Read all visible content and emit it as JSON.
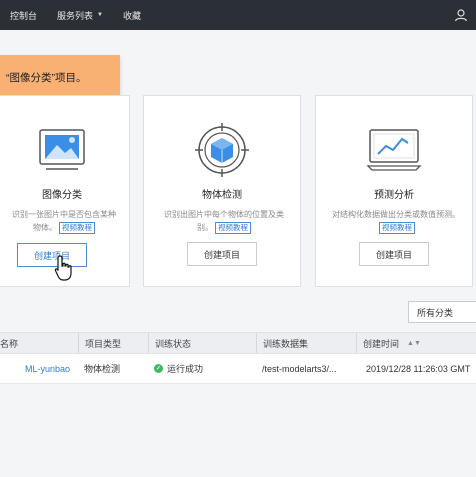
{
  "topbar": {
    "menu1": "控制台",
    "menu2": "服务列表",
    "menu3": "收藏",
    "right_icon": "user-icon"
  },
  "tooltip": {
    "text": "“图像分类”项目。"
  },
  "cards": [
    {
      "icon": "image-icon",
      "title": "图像分类",
      "desc": "识别一张图片中是否包含某种物体。",
      "video_link": "视频教程",
      "button": "创建项目"
    },
    {
      "icon": "target-cube-icon",
      "title": "物体检测",
      "desc": "识别出图片中每个物体的位置及类别。",
      "video_link": "视频教程",
      "button": "创建项目"
    },
    {
      "icon": "chart-monitor-icon",
      "title": "预测分析",
      "desc": "对结构化数据做出分类或数值预测。",
      "video_link": "视频教程",
      "button": "创建项目"
    }
  ],
  "filter": {
    "label": "所有分类"
  },
  "table": {
    "headers": [
      "名称",
      "项目类型",
      "训练状态",
      "训练数据集",
      "创建时间"
    ],
    "rows": [
      {
        "name": "ML-yunbao",
        "type": "物体检测",
        "status": "运行成功",
        "dataset": "/test-modelarts3/...",
        "created": "2019/12/28 11:26:03 GMT"
      }
    ]
  },
  "colors": {
    "topbar": "#2b2f36",
    "tooltip": "#f9b173",
    "accent": "#2f7bd1",
    "success": "#3fb864"
  }
}
